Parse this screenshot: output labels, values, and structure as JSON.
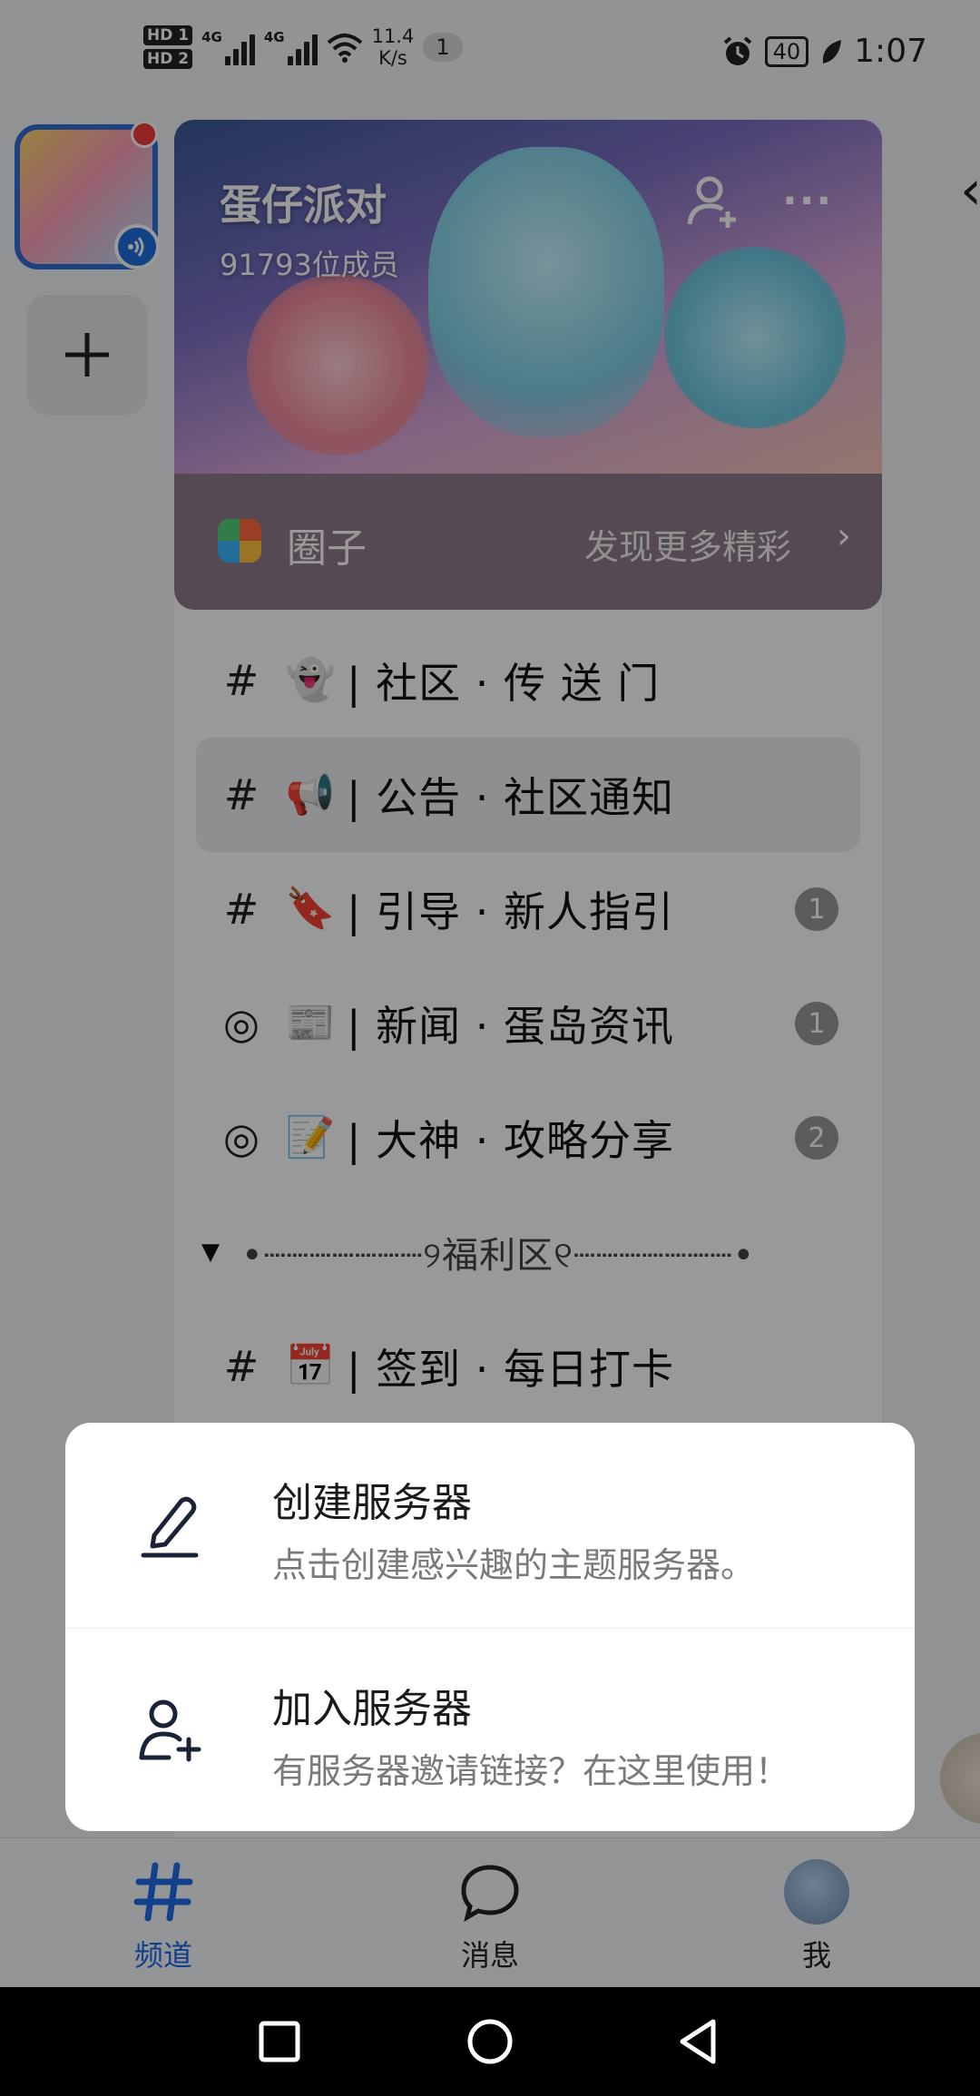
{
  "status_bar": {
    "hd1": "HD 1",
    "hd2": "HD 2",
    "net1": "4G",
    "net2": "4G",
    "speed_value": "11.4",
    "speed_unit": "K/s",
    "notif_count": "1",
    "battery": "40",
    "time": "1:07"
  },
  "server": {
    "name": "蛋仔派对",
    "members": "91793位成员",
    "circle_label": "圈子",
    "circle_more": "发现更多精彩"
  },
  "channels": [
    {
      "icon": "#",
      "emoji": "👻",
      "name": "| 社区 · 传 送 门",
      "badge": ""
    },
    {
      "icon": "#",
      "emoji": "📢",
      "name": "| 公告 · 社区通知",
      "badge": ""
    },
    {
      "icon": "#",
      "emoji": "🔖",
      "name": "| 引导 · 新人指引",
      "badge": "1"
    },
    {
      "icon": "◎",
      "emoji": "📰",
      "name": "| 新闻 · 蛋岛资讯",
      "badge": "1"
    },
    {
      "icon": "◎",
      "emoji": "📝",
      "name": "| 大神 · 攻略分享",
      "badge": "2"
    }
  ],
  "category": {
    "label": "•┈┈┈┈┈┈┈୨福利区୧┈┈┈┈┈┈┈•"
  },
  "channel_after": {
    "icon": "#",
    "emoji": "📅",
    "name": "| 签到 · 每日打卡"
  },
  "popup": {
    "create_title": "创建服务器",
    "create_sub": "点击创建感兴趣的主题服务器。",
    "join_title": "加入服务器",
    "join_sub": "有服务器邀请链接？在这里使用！"
  },
  "tabs": [
    {
      "label": "频道",
      "icon": "hash-icon"
    },
    {
      "label": "消息",
      "icon": "chat-bubble-icon"
    },
    {
      "label": "我",
      "icon": "avatar"
    }
  ],
  "colors": {
    "accent": "#1f6be6",
    "dim_overlay": "rgba(0,0,0,0.40)",
    "badge_gray": "#9a9a9a"
  }
}
